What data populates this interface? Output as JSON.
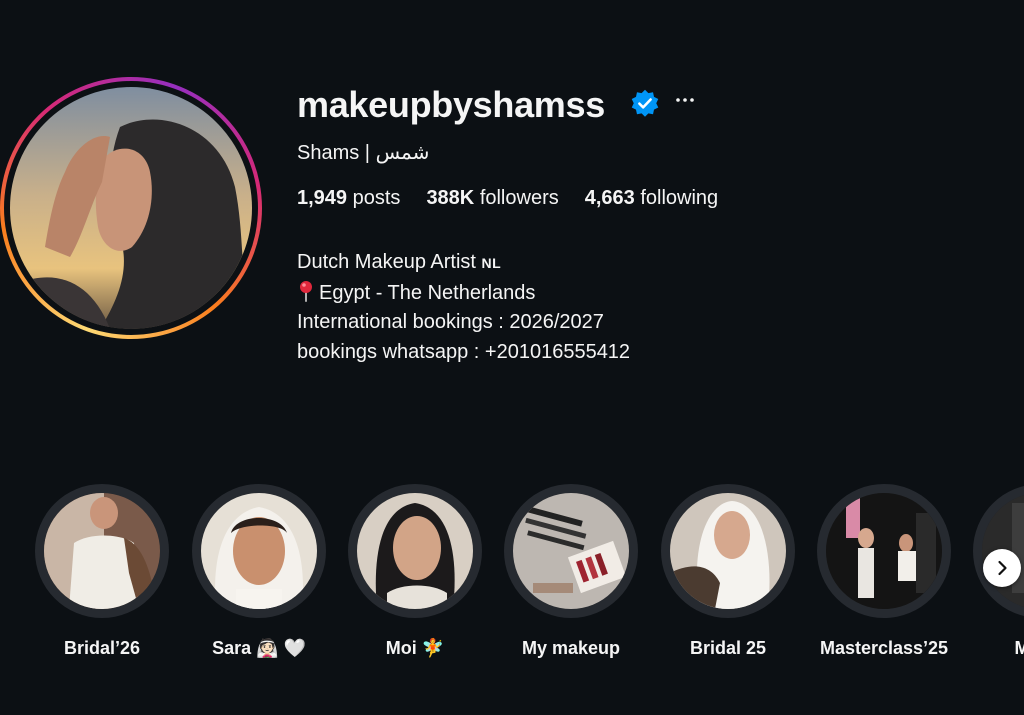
{
  "profile": {
    "username": "makeupbyshamss",
    "full_name": "Shams | شمس",
    "verified": true,
    "stats": {
      "posts_count": "1,949",
      "posts_label": "posts",
      "followers_count": "388K",
      "followers_label": "followers",
      "following_count": "4,663",
      "following_label": "following"
    },
    "bio": {
      "line1": "Dutch Makeup Artist",
      "line1_flag": "NL",
      "line2": "Egypt - The Netherlands",
      "line3": "International bookings : 2026/2027",
      "line4": "bookings whatsapp : +201016555412"
    }
  },
  "highlights": [
    {
      "label": "Bridal’26"
    },
    {
      "label": "Sara 👰🏻 🤍"
    },
    {
      "label": "Moi 🧚"
    },
    {
      "label": "My makeup"
    },
    {
      "label": "Bridal 25"
    },
    {
      "label": "Masterclass’25"
    },
    {
      "label": "Maste"
    }
  ],
  "colors": {
    "background": "#0c1014",
    "text": "#f5f5f5",
    "verified_blue": "#0095f6",
    "story_ring": [
      "#feda75",
      "#fa7e1e",
      "#d62976",
      "#962fbf"
    ]
  },
  "icons": {
    "verified": "verified-badge-icon",
    "more": "more-options-icon",
    "pin": "round-pushpin-icon",
    "next": "chevron-right-icon"
  }
}
